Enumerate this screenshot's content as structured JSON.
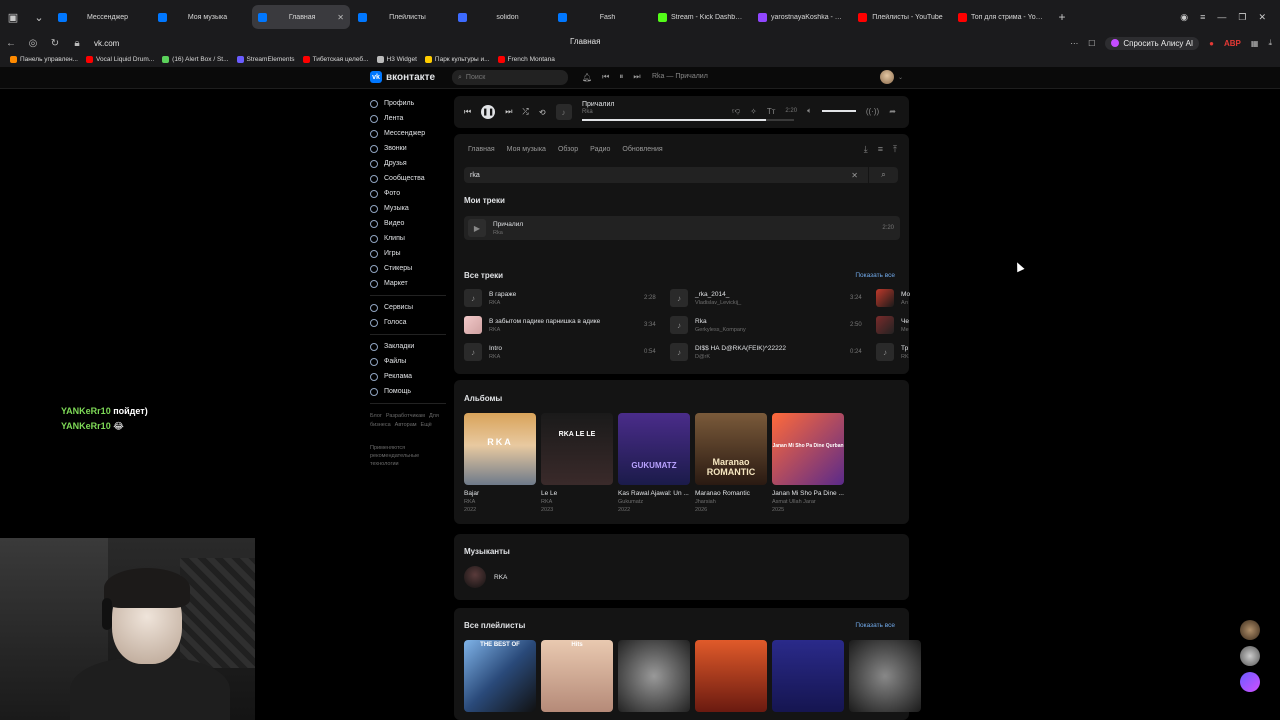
{
  "browser": {
    "tabs": [
      {
        "label": "Мессенджер",
        "color": "#0077ff",
        "active": false
      },
      {
        "label": "Моя музыка",
        "color": "#0077ff",
        "active": false
      },
      {
        "label": "Главная",
        "color": "#0077ff",
        "active": true
      },
      {
        "label": "Плейлисты",
        "color": "#0077ff",
        "active": false
      },
      {
        "label": "solidon",
        "color": "#3d6bff",
        "active": false
      },
      {
        "label": "Fash",
        "color": "#0077ff",
        "active": false
      },
      {
        "label": "Stream - Kick Dashboard",
        "color": "#53fc18",
        "active": false
      },
      {
        "label": "yarostnayaKoshka - Twitch",
        "color": "#9146ff",
        "active": false
      },
      {
        "label": "Плейлисты - YouTube",
        "color": "#ff0000",
        "active": false
      },
      {
        "label": "Топ для стрима - YouTube",
        "color": "#ff0000",
        "active": false
      }
    ],
    "url": "vk.com",
    "page_title": "Главная",
    "alisa_label": "Спросить Алису AI",
    "bookmarks": [
      {
        "label": "Панель управлен...",
        "color": "#ff8a00"
      },
      {
        "label": "Vocal Liquid Drum...",
        "color": "#ff0000"
      },
      {
        "label": "(16) Alert Box / St...",
        "color": "#5bd15b"
      },
      {
        "label": "StreamElements",
        "color": "#6a5cff"
      },
      {
        "label": "Тибетская целеб...",
        "color": "#ff0000"
      },
      {
        "label": "H3 Widget",
        "color": "#bbbbbb"
      },
      {
        "label": "Парк культуры и...",
        "color": "#ffcc00"
      },
      {
        "label": "French Montana",
        "color": "#ff0000"
      }
    ]
  },
  "vk": {
    "logo_text": "вконтакте",
    "search_placeholder": "Поиск",
    "header_track": "Rka — Причалил",
    "nav": {
      "main": [
        "Профиль",
        "Лента",
        "Мессенджер",
        "Звонки",
        "Друзья",
        "Сообщества",
        "Фото",
        "Музыка",
        "Видео",
        "Клипы",
        "Игры",
        "Стикеры",
        "Маркет"
      ],
      "services": [
        "Сервисы",
        "Голоса"
      ],
      "extra": [
        "Закладки",
        "Файлы",
        "Реклама",
        "Помощь"
      ],
      "footer_links": [
        "Блог",
        "Разработчикам",
        "Для бизнеса",
        "Авторам",
        "Ещё"
      ],
      "footer_note": "Применяются рекомендательные технологии"
    },
    "player": {
      "title": "Причалил",
      "artist": "Rka",
      "time": "2:20",
      "progress": 0.87,
      "volume": 1.0
    },
    "music_tabs": [
      "Главная",
      "Моя музыка",
      "Обзор",
      "Радио",
      "Обновления"
    ],
    "search_value": "rka",
    "my_tracks_title": "Мои треки",
    "my_track": {
      "title": "Причалил",
      "artist": "Rka",
      "duration": "2:20"
    },
    "all_tracks_title": "Все треки",
    "show_all": "Показать все",
    "all_tracks": [
      {
        "title": "В гараже",
        "artist": "RKA",
        "duration": "2:28"
      },
      {
        "title": "В забытом падике парнишка в адике",
        "artist": "RKA",
        "duration": "3:34"
      },
      {
        "title": "Intro",
        "artist": "RKA",
        "duration": "0:54"
      },
      {
        "title": "_rka_2014_",
        "artist": "Vladislav_Levickij_",
        "duration": "3:24"
      },
      {
        "title": "Rka",
        "artist": "Gerkyless_Kompany",
        "duration": "2:50"
      },
      {
        "title": "DI$$ НА D@RKA(FEIK)^22222",
        "artist": "D@rK",
        "duration": "0:24"
      },
      {
        "title": "Мо",
        "artist": "Ал",
        "duration": ""
      },
      {
        "title": "Че",
        "artist": "Ме",
        "duration": ""
      },
      {
        "title": "Тр",
        "artist": "RK",
        "duration": ""
      }
    ],
    "albums_title": "Альбомы",
    "albums": [
      {
        "title": "Bajar",
        "artist": "RKA",
        "year": "2022",
        "art_text": "RKA"
      },
      {
        "title": "Le Le",
        "artist": "RKA",
        "year": "2023",
        "art_text": "RKA LE LE"
      },
      {
        "title": "Kas Rawal Ajawal: Un ...",
        "artist": "Gukumatz",
        "year": "2022",
        "art_text": "GUKUMATZ"
      },
      {
        "title": "Maranao Romantic",
        "artist": "Jharsiah",
        "year": "2026",
        "art_text": "Maranao ROMANTIC"
      },
      {
        "title": "Janan Mi Sho Pa Dine ...",
        "artist": "Asmat Ullah Jarar",
        "year": "2025",
        "art_text": "Janan Mi Sho Pa Dine Qurban"
      }
    ],
    "musicians_title": "Музыканты",
    "musician": "RKA",
    "playlists_title": "Все плейлисты",
    "playlists_show_all": "Показать все",
    "playlist_art_text": [
      "THE BEST OF",
      "Hits",
      "",
      "",
      "",
      ""
    ]
  },
  "stream": {
    "chat": [
      {
        "user": "YANKeRr10",
        "text": "пойдет)"
      },
      {
        "user": "YANKeRr10",
        "text": "😂"
      }
    ]
  }
}
